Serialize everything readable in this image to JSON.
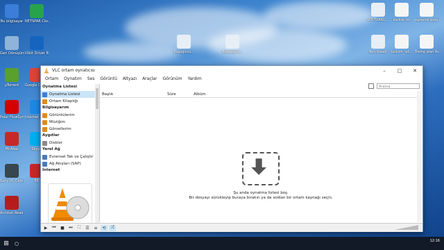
{
  "desktop": {
    "left_icons": [
      {
        "label": "Bu bilgisayar",
        "icon": "computer-icon",
        "color": "#3b7dd8"
      },
      {
        "label": "NETSPAR Cloud",
        "icon": "netspar-icon",
        "color": "#27a34b"
      },
      {
        "label": "Geri Dönüşüm",
        "icon": "recycle-bin-icon",
        "color": "#8fb3d9"
      },
      {
        "label": "IObit Driver Booster",
        "icon": "driver-booster-icon",
        "color": "#1565c0"
      },
      {
        "label": "µTorrent",
        "icon": "utorrent-icon",
        "color": "#5aa02c"
      },
      {
        "label": "Google Chrome",
        "icon": "chrome-icon",
        "color": "#db4437"
      },
      {
        "label": "Polar FlowSync",
        "icon": "polar-icon",
        "color": "#d50000"
      },
      {
        "label": "Internet Explorer",
        "icon": "ie-icon",
        "color": "#1e88e5"
      },
      {
        "label": "McAfee",
        "icon": "mcafee-icon",
        "color": "#c62828"
      },
      {
        "label": "Skype",
        "icon": "skype-icon",
        "color": "#00aff0"
      },
      {
        "label": "Sony PC Companion",
        "icon": "sony-icon",
        "color": "#37474f"
      },
      {
        "label": "EK",
        "icon": "ek-icon",
        "color": "#c62828"
      },
      {
        "label": "Acrobat Reader DC",
        "icon": "acrobat-icon",
        "color": "#b71c1c"
      }
    ],
    "right_icons": [
      {
        "label": "VIP-TURKU...",
        "icon": "media-file-icon",
        "color": "#e8eef5"
      },
      {
        "label": "kariisk.txt",
        "icon": "text-file-icon",
        "color": "#f5f5f5"
      },
      {
        "label": "egzersiz programi.txt",
        "icon": "text-file-icon",
        "color": "#f5f5f5"
      },
      {
        "label": "Yeni klasör",
        "icon": "media-file-icon",
        "color": "#e8eef5"
      },
      {
        "label": "turkish_ipt...",
        "icon": "text-file-icon",
        "color": "#f5f5f5"
      },
      {
        "label": "Treing plan Recep.txt",
        "icon": "text-file-icon",
        "color": "#f5f5f5"
      }
    ],
    "center_icons": [
      {
        "label": "Koşugünü...",
        "icon": "media-file-icon",
        "color": "#e8eef5"
      },
      {
        "label": "Koşugünü...",
        "icon": "media-file-icon",
        "color": "#e8eef5"
      }
    ]
  },
  "window": {
    "title": "VLC ortam oynatıcısı",
    "menu": [
      "Ortam",
      "Oynatım",
      "Ses",
      "Görüntü",
      "Altyazı",
      "Araçlar",
      "Görünüm",
      "Yardım"
    ],
    "search_placeholder": "Arama",
    "accent": "#cce4f7"
  },
  "sidebar": {
    "sections": [
      {
        "heading": "Oynatma Listesi",
        "items": [
          {
            "label": "Oynatma Listesi",
            "icon": "playlist-icon",
            "selected": true
          },
          {
            "label": "Ortam Kitaplığı",
            "icon": "library-icon",
            "selected": false
          }
        ]
      },
      {
        "heading": "Bilgisayarım",
        "items": [
          {
            "label": "Görüntülerim",
            "icon": "videos-icon",
            "selected": false
          },
          {
            "label": "Müziğim",
            "icon": "music-icon",
            "selected": false
          },
          {
            "label": "Görsellerim",
            "icon": "pictures-icon",
            "selected": false
          }
        ]
      },
      {
        "heading": "Aygıtlar",
        "items": [
          {
            "label": "Diskler",
            "icon": "disc-icon",
            "selected": false
          }
        ]
      },
      {
        "heading": "Yerel Ağ",
        "items": [
          {
            "label": "Evrensel Tak ve Çalıştır",
            "icon": "upnp-icon",
            "selected": false
          },
          {
            "label": "Ağ Akışları (SAP)",
            "icon": "network-icon",
            "selected": false
          }
        ]
      },
      {
        "heading": "İnternet",
        "items": []
      }
    ]
  },
  "playlist": {
    "columns": [
      "Başlık",
      "Süre",
      "Albüm"
    ],
    "empty_line1": "Şu anda oynatma listesi boş.",
    "empty_line2": "Bir dosyayı sürükleyip buraya bırakın ya da soldan bir ortam kaynağı seçin."
  },
  "controls": {
    "volume_label": "100%"
  },
  "taskbar": {
    "time": "12:16"
  }
}
